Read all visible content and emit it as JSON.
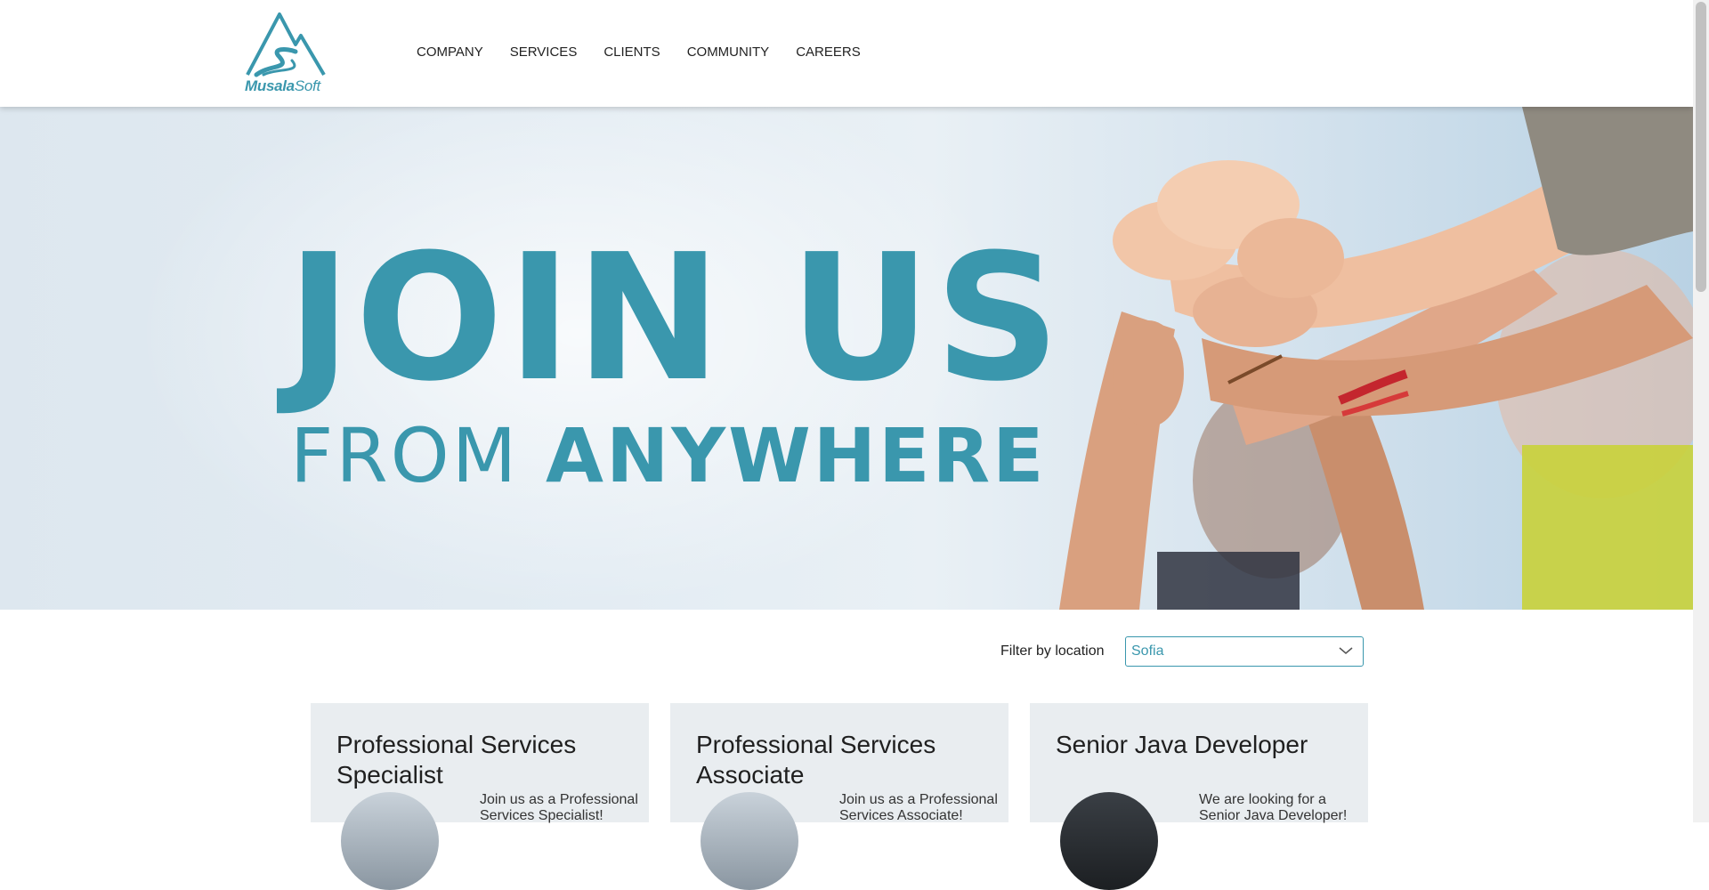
{
  "brand": {
    "name_bold": "Musala",
    "name_light": "Soft",
    "color": "#3a97ad"
  },
  "nav": {
    "items": [
      "COMPANY",
      "SERVICES",
      "CLIENTS",
      "COMMUNITY",
      "CAREERS"
    ]
  },
  "hero": {
    "title": "JOIN US",
    "subtitle_light": "FROM ",
    "subtitle_bold": "ANYWHERE"
  },
  "filter": {
    "label": "Filter by location",
    "selected": "Sofia",
    "icon": "chevron-down-icon"
  },
  "jobs": [
    {
      "title": "Professional Services Specialist",
      "description": "Join us as a Professional Services Specialist!"
    },
    {
      "title": "Professional Services Associate",
      "description": "Join us as a Professional Services Associate!"
    },
    {
      "title": "Senior Java Developer",
      "description": "We are looking for a Senior Java Developer!"
    }
  ]
}
